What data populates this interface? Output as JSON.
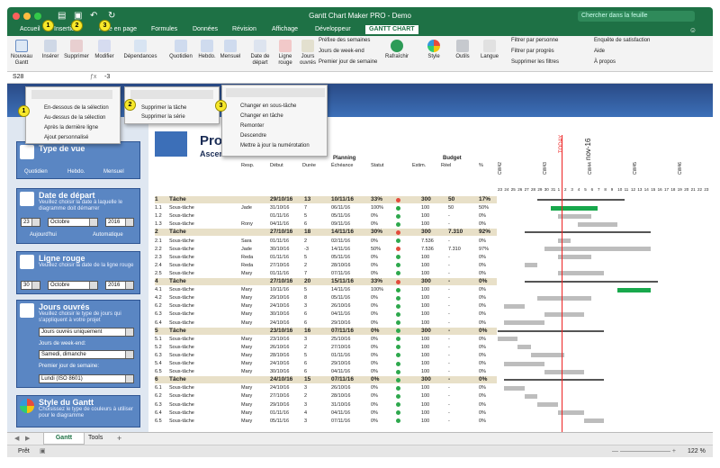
{
  "app": {
    "title": "Gantt Chart Maker PRO - Demo",
    "search_placeholder": "Chercher dans la feuille"
  },
  "tabs": [
    "Accueil",
    "Insertion",
    "Mise en page",
    "Formules",
    "Données",
    "Révision",
    "Affichage",
    "Développeur",
    "GANTT CHART"
  ],
  "ribbon": {
    "buttons": [
      "Nouveau Gantt",
      "Insérer",
      "Supprimer",
      "Modifier",
      "Dépendances",
      "Quotidien",
      "Hebdo.",
      "Mensuel",
      "Date de départ",
      "Ligne rouge",
      "Jours ouvrés",
      "Rafraîchir",
      "Style",
      "Outils",
      "Langue"
    ],
    "menus": [
      "Préfixe des semaines",
      "Jours de week-end",
      "Premier jour de semaine"
    ],
    "filters": [
      "Filtrer par personne",
      "Filtrer par progrès",
      "Supprimer les filtres"
    ],
    "help": [
      "Enquête de satisfaction",
      "Aide",
      "À propos"
    ]
  },
  "formula": {
    "cell": "S28",
    "value": "-3"
  },
  "callouts": [
    "1",
    "2",
    "3",
    "1",
    "2",
    "3"
  ],
  "popup1": [
    "En-dessous de la sélection",
    "Au-dessus de la sélection",
    "Après la dernière ligne",
    "Ajout personnalisé"
  ],
  "popup2": [
    "Supprimer la tâche",
    "Supprimer la série"
  ],
  "popup3": [
    "Changer en sous-tâche",
    "Changer en tâche",
    "Remonter",
    "Descendre",
    "Mettre à jour la numérotation"
  ],
  "sheet": {
    "title": "Pro",
    "subtitle": "Ascension ... aise",
    "planning": "Planning",
    "budget": "Budget",
    "today": "TODAY",
    "month": "nov-16"
  },
  "pane": {
    "vue": {
      "title": "Type de vue",
      "labels": [
        "Quotidien",
        "Hebdo.",
        "Mensuel"
      ]
    },
    "depart": {
      "title": "Date de départ",
      "desc": "Veuillez choisir la date à laquelle le diagramme doit démarrer",
      "day": "23",
      "month": "Octobre",
      "year": "2016",
      "today": "Aujourd'hui",
      "auto": "Automatique"
    },
    "rouge": {
      "title": "Ligne rouge",
      "desc": "Veuillez choisir la date de la ligne rouge",
      "day": "30",
      "month": "Octobre",
      "year": "2016"
    },
    "ouvres": {
      "title": "Jours ouvrés",
      "desc": "Veuillez choisir le type de jours qui s'appliquent à votre projet",
      "type": "Jours ouvrés uniquement",
      "we_label": "Jours de week-end:",
      "we": "Samedi, dimanche",
      "first_label": "Premier jour de semaine:",
      "first": "Lundi (ISO 8601)"
    },
    "style": {
      "title": "Style du Gantt",
      "desc": "Choisissez le type de couleurs à utiliser pour le diagramme"
    }
  },
  "headers": [
    "Resp.",
    "Début",
    "Durée",
    "Échéance",
    "Statut",
    "Estim.",
    "Réel",
    "%"
  ],
  "weeks": [
    "CW42",
    "CW43",
    "CW44",
    "CW45",
    "CW46"
  ],
  "days": [
    "23",
    "24",
    "25",
    "26",
    "27",
    "28",
    "29",
    "30",
    "31",
    "1",
    "2",
    "3",
    "4",
    "5",
    "6",
    "7",
    "8",
    "9",
    "10",
    "11",
    "12",
    "13",
    "14",
    "15",
    "16",
    "17",
    "18",
    "19",
    "20",
    "21",
    "22",
    "23"
  ],
  "rows": [
    {
      "id": "1",
      "name": "Tâche",
      "resp": "",
      "start": "29/10/16",
      "dur": "13",
      "end": "10/11/16",
      "pct": "33%",
      "est": "300",
      "real": "50",
      "p2": "17%",
      "task": true
    },
    {
      "id": "1.1",
      "name": "Sous-tâche",
      "resp": "Jade",
      "start": "31/10/16",
      "dur": "7",
      "end": "06/11/16",
      "pct": "100%",
      "est": "100",
      "real": "50",
      "p2": "50%"
    },
    {
      "id": "1.2",
      "name": "Sous-tâche",
      "resp": "",
      "start": "01/11/16",
      "dur": "5",
      "end": "05/11/16",
      "pct": "0%",
      "est": "100",
      "real": "-",
      "p2": "0%"
    },
    {
      "id": "1.3",
      "name": "Sous-tâche",
      "resp": "Rony",
      "start": "04/11/16",
      "dur": "6",
      "end": "09/11/16",
      "pct": "0%",
      "est": "100",
      "real": "-",
      "p2": "0%"
    },
    {
      "id": "2",
      "name": "Tâche",
      "resp": "",
      "start": "27/10/16",
      "dur": "18",
      "end": "14/11/16",
      "pct": "30%",
      "est": "300",
      "real": "7.310",
      "p2": "92%",
      "task": true
    },
    {
      "id": "2.1",
      "name": "Sous-tâche",
      "resp": "Sara",
      "start": "01/11/16",
      "dur": "2",
      "end": "02/11/16",
      "pct": "0%",
      "est": "7.536",
      "real": "-",
      "p2": "0%"
    },
    {
      "id": "2.2",
      "name": "Sous-tâche",
      "resp": "Jade",
      "start": "30/10/16",
      "dur": "-3",
      "end": "14/11/16",
      "pct": "50%",
      "est": "7.536",
      "real": "7.310",
      "p2": "97%"
    },
    {
      "id": "2.3",
      "name": "Sous-tâche",
      "resp": "Reda",
      "start": "01/11/16",
      "dur": "5",
      "end": "05/11/16",
      "pct": "0%",
      "est": "100",
      "real": "-",
      "p2": "0%"
    },
    {
      "id": "2.4",
      "name": "Sous-tâche",
      "resp": "Reda",
      "start": "27/10/16",
      "dur": "2",
      "end": "28/10/16",
      "pct": "0%",
      "est": "100",
      "real": "-",
      "p2": "0%"
    },
    {
      "id": "2.5",
      "name": "Sous-tâche",
      "resp": "Mary",
      "start": "01/11/16",
      "dur": "7",
      "end": "07/11/16",
      "pct": "0%",
      "est": "100",
      "real": "-",
      "p2": "0%"
    },
    {
      "id": "4",
      "name": "Tâche",
      "resp": "",
      "start": "27/10/16",
      "dur": "20",
      "end": "15/11/16",
      "pct": "33%",
      "est": "300",
      "real": "-",
      "p2": "0%",
      "task": true
    },
    {
      "id": "4.1",
      "name": "Sous-tâche",
      "resp": "Mary",
      "start": "10/11/16",
      "dur": "5",
      "end": "14/11/16",
      "pct": "100%",
      "est": "100",
      "real": "-",
      "p2": "0%"
    },
    {
      "id": "4.2",
      "name": "Sous-tâche",
      "resp": "Mary",
      "start": "29/10/16",
      "dur": "8",
      "end": "05/11/16",
      "pct": "0%",
      "est": "100",
      "real": "-",
      "p2": "0%"
    },
    {
      "id": "6.2",
      "name": "Sous-tâche",
      "resp": "Mary",
      "start": "24/10/16",
      "dur": "3",
      "end": "26/10/16",
      "pct": "0%",
      "est": "100",
      "real": "-",
      "p2": "0%"
    },
    {
      "id": "6.3",
      "name": "Sous-tâche",
      "resp": "Mary",
      "start": "30/10/16",
      "dur": "6",
      "end": "04/11/16",
      "pct": "0%",
      "est": "100",
      "real": "-",
      "p2": "0%"
    },
    {
      "id": "6.4",
      "name": "Sous-tâche",
      "resp": "Mary",
      "start": "24/10/16",
      "dur": "6",
      "end": "29/10/16",
      "pct": "0%",
      "est": "100",
      "real": "-",
      "p2": "0%"
    },
    {
      "id": "5",
      "name": "Tâche",
      "resp": "",
      "start": "23/10/16",
      "dur": "16",
      "end": "07/11/16",
      "pct": "0%",
      "est": "300",
      "real": "-",
      "p2": "0%",
      "task": true
    },
    {
      "id": "5.1",
      "name": "Sous-tâche",
      "resp": "Mary",
      "start": "23/10/16",
      "dur": "3",
      "end": "25/10/16",
      "pct": "0%",
      "est": "100",
      "real": "-",
      "p2": "0%"
    },
    {
      "id": "5.2",
      "name": "Sous-tâche",
      "resp": "Mary",
      "start": "26/10/16",
      "dur": "2",
      "end": "27/10/16",
      "pct": "0%",
      "est": "100",
      "real": "-",
      "p2": "0%"
    },
    {
      "id": "6.3",
      "name": "Sous-tâche",
      "resp": "Mary",
      "start": "28/10/16",
      "dur": "5",
      "end": "01/11/16",
      "pct": "0%",
      "est": "100",
      "real": "-",
      "p2": "0%"
    },
    {
      "id": "5.4",
      "name": "Sous-tâche",
      "resp": "Mary",
      "start": "24/10/16",
      "dur": "6",
      "end": "29/10/16",
      "pct": "0%",
      "est": "100",
      "real": "-",
      "p2": "0%"
    },
    {
      "id": "6.5",
      "name": "Sous-tâche",
      "resp": "Mary",
      "start": "30/10/16",
      "dur": "6",
      "end": "04/11/16",
      "pct": "0%",
      "est": "100",
      "real": "-",
      "p2": "0%"
    },
    {
      "id": "6",
      "name": "Tâche",
      "resp": "",
      "start": "24/10/16",
      "dur": "15",
      "end": "07/11/16",
      "pct": "0%",
      "est": "300",
      "real": "-",
      "p2": "0%",
      "task": true
    },
    {
      "id": "6.1",
      "name": "Sous-tâche",
      "resp": "Mary",
      "start": "24/10/16",
      "dur": "3",
      "end": "26/10/16",
      "pct": "0%",
      "est": "100",
      "real": "-",
      "p2": "0%"
    },
    {
      "id": "6.2",
      "name": "Sous-tâche",
      "resp": "Mary",
      "start": "27/10/16",
      "dur": "2",
      "end": "28/10/16",
      "pct": "0%",
      "est": "100",
      "real": "-",
      "p2": "0%"
    },
    {
      "id": "6.3",
      "name": "Sous-tâche",
      "resp": "Mary",
      "start": "29/10/16",
      "dur": "3",
      "end": "31/10/16",
      "pct": "0%",
      "est": "100",
      "real": "-",
      "p2": "0%"
    },
    {
      "id": "6.4",
      "name": "Sous-tâche",
      "resp": "Mary",
      "start": "01/11/16",
      "dur": "4",
      "end": "04/11/16",
      "pct": "0%",
      "est": "100",
      "real": "-",
      "p2": "0%"
    },
    {
      "id": "6.5",
      "name": "Sous-tâche",
      "resp": "Mary",
      "start": "05/11/16",
      "dur": "3",
      "end": "07/11/16",
      "pct": "0%",
      "est": "100",
      "real": "-",
      "p2": "0%"
    }
  ],
  "sheet_tabs": [
    "Gantt",
    "Tools"
  ],
  "status": {
    "ready": "Prêt",
    "zoom": "122 %"
  },
  "colors": {
    "green": "#1e7145",
    "bar": "#18a84c",
    "grey": "#bdbdbd",
    "task": "#e8e0c8",
    "blue": "#2f5592"
  }
}
